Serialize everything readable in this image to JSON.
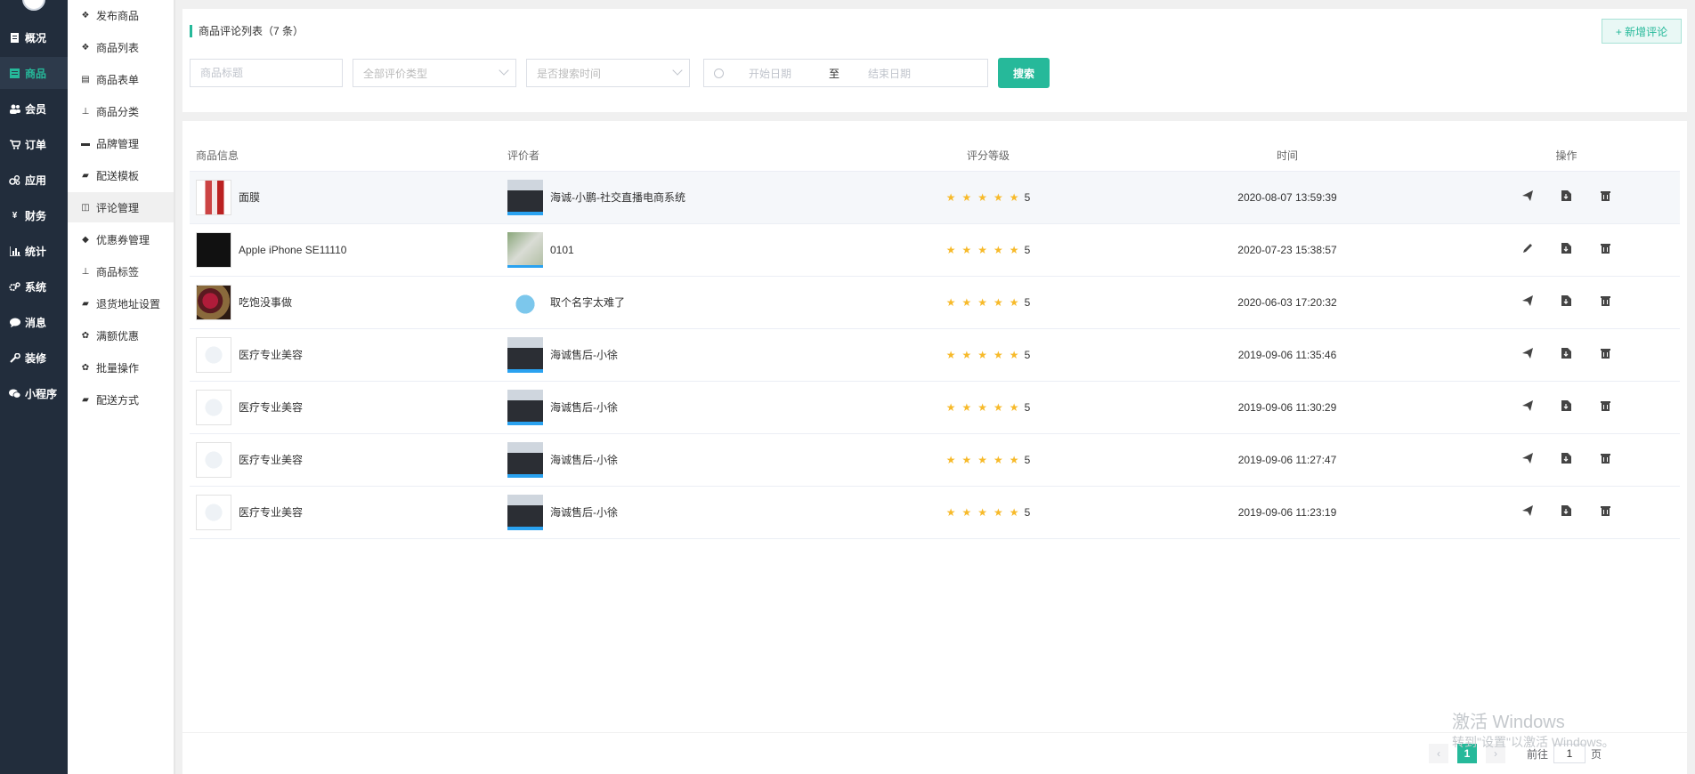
{
  "nav1": [
    {
      "label": "概况",
      "icon": "file-icon"
    },
    {
      "label": "商品",
      "icon": "list-icon"
    },
    {
      "label": "会员",
      "icon": "users-icon"
    },
    {
      "label": "订单",
      "icon": "cart-icon"
    },
    {
      "label": "应用",
      "icon": "apps-icon"
    },
    {
      "label": "财务",
      "icon": "yen-icon"
    },
    {
      "label": "统计",
      "icon": "chart-icon"
    },
    {
      "label": "系统",
      "icon": "gears-icon"
    },
    {
      "label": "消息",
      "icon": "chat-icon"
    },
    {
      "label": "装修",
      "icon": "wrench-icon"
    },
    {
      "label": "小程序",
      "icon": "wechat-icon"
    }
  ],
  "nav2": [
    {
      "label": "发布商品",
      "icon": "cubes-icon"
    },
    {
      "label": "商品列表",
      "icon": "cubes-icon"
    },
    {
      "label": "商品表单",
      "icon": "form-icon"
    },
    {
      "label": "商品分类",
      "icon": "sitemap-icon"
    },
    {
      "label": "品牌管理",
      "icon": "briefcase-icon"
    },
    {
      "label": "配送模板",
      "icon": "truck-icon"
    },
    {
      "label": "评论管理",
      "icon": "columns-icon"
    },
    {
      "label": "优惠券管理",
      "icon": "tags-icon"
    },
    {
      "label": "商品标签",
      "icon": "sitemap-icon"
    },
    {
      "label": "退货地址设置",
      "icon": "truck-icon"
    },
    {
      "label": "满额优惠",
      "icon": "gift-icon"
    },
    {
      "label": "批量操作",
      "icon": "gift-icon"
    },
    {
      "label": "配送方式",
      "icon": "truck-icon"
    }
  ],
  "header": {
    "title": "商品评论列表（7 条）",
    "add_label": "+ 新增评论"
  },
  "filters": {
    "goods_title_placeholder": "商品标题",
    "rating_type": "全部评价类型",
    "search_time": "是否搜索时间",
    "start_date": "开始日期",
    "sep": "至",
    "end_date": "结束日期",
    "search_label": "搜索"
  },
  "table": {
    "headers": [
      "商品信息",
      "评价者",
      "评分等级",
      "时间",
      "操作"
    ],
    "rows": [
      {
        "goods": "面膜",
        "user": "海诚-小鹏-社交直播电商系统",
        "score": "5",
        "time": "2020-08-07 13:59:39"
      },
      {
        "goods": "Apple iPhone SE11110",
        "user": "0101",
        "score": "5",
        "time": "2020-07-23 15:38:57"
      },
      {
        "goods": "吃饱没事做",
        "user": "取个名字太难了",
        "score": "5",
        "time": "2020-06-03 17:20:32"
      },
      {
        "goods": "医疗专业美容",
        "user": "海诚售后-小徐",
        "score": "5",
        "time": "2019-09-06 11:35:46"
      },
      {
        "goods": "医疗专业美容",
        "user": "海诚售后-小徐",
        "score": "5",
        "time": "2019-09-06 11:30:29"
      },
      {
        "goods": "医疗专业美容",
        "user": "海诚售后-小徐",
        "score": "5",
        "time": "2019-09-06 11:27:47"
      },
      {
        "goods": "医疗专业美容",
        "user": "海诚售后-小徐",
        "score": "5",
        "time": "2019-09-06 11:23:19"
      }
    ]
  },
  "pager": {
    "current": "1",
    "goto": "前往",
    "page_value": "1",
    "page_unit": "页"
  },
  "watermark": {
    "line1": "激活 Windows",
    "line2": "转到\"设置\"以激活 Windows。"
  },
  "colors": {
    "accent": "#26b99a",
    "star": "#f7ba2a",
    "nav_bg": "#222d3c"
  }
}
